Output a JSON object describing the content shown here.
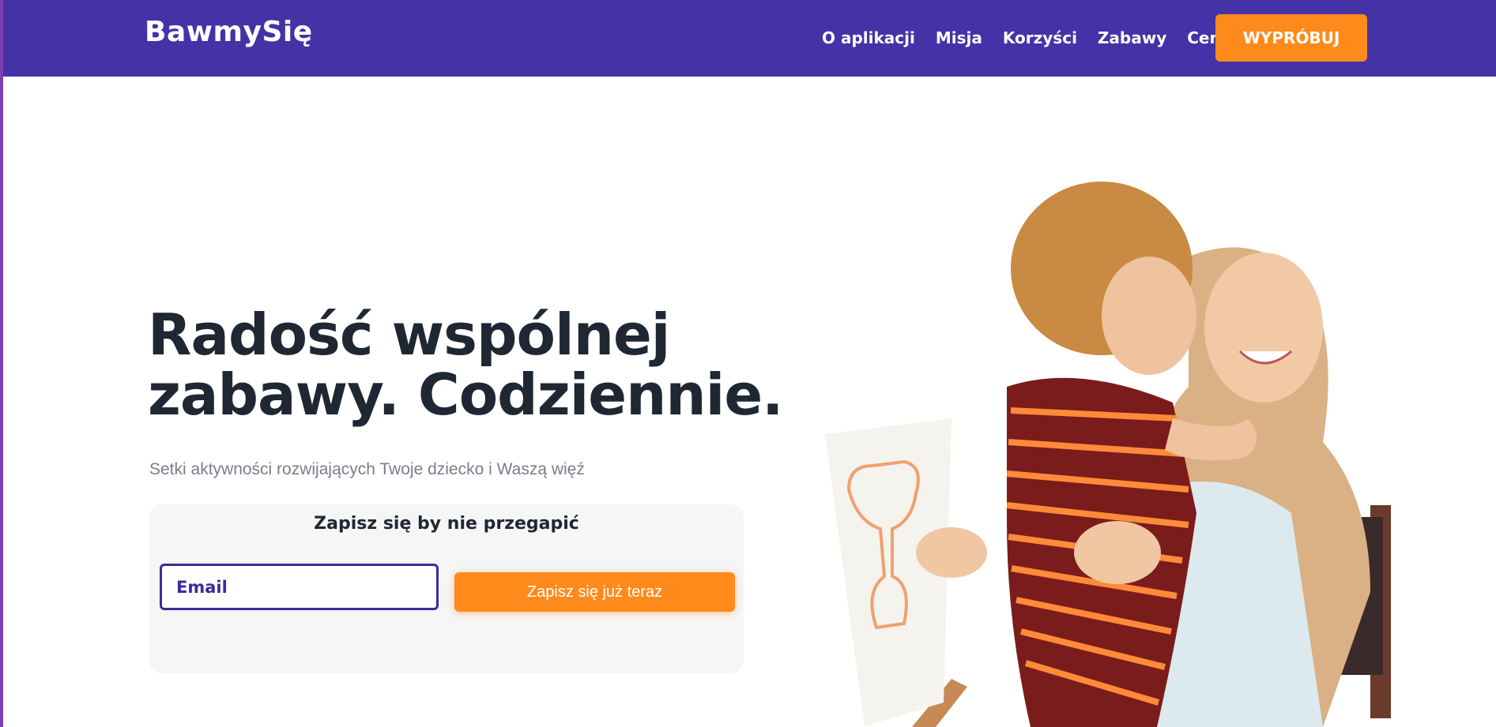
{
  "header": {
    "logo": "BawmySię",
    "nav": [
      {
        "label": "O aplikacji"
      },
      {
        "label": "Misja"
      },
      {
        "label": "Korzyści"
      },
      {
        "label": "Zabawy"
      },
      {
        "label": "Cennik"
      }
    ],
    "cta_label": "WYPRÓBUJ"
  },
  "hero": {
    "title_line1": "Radość wspólnej",
    "title_line2": "zabawy. Codziennie.",
    "subtitle": "Setki aktywności rozwijających Twoje dziecko i Waszą więź",
    "signup": {
      "heading": "Zapisz się by nie przegapić",
      "email_placeholder": "Email",
      "button_label": "Zapisz się już teraz"
    }
  },
  "colors": {
    "brand_purple": "#4433a6",
    "accent_orange": "#ff8a1c",
    "heading_dark": "#1f2733",
    "subtitle_gray": "#7a7e8c"
  }
}
